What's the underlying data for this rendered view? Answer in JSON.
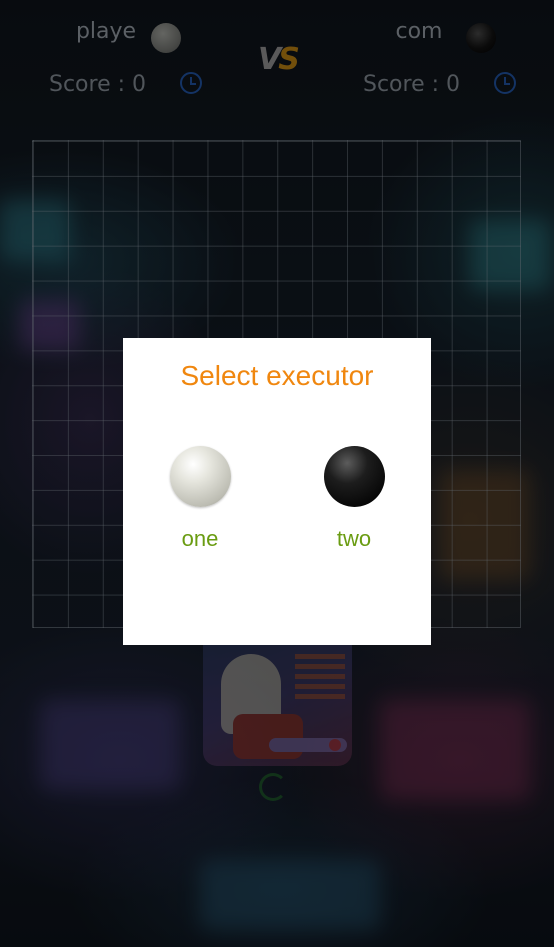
{
  "header": {
    "player1": {
      "name": "playe\nr",
      "score_label": "Score : 0",
      "stone": "white"
    },
    "player2": {
      "name": "com\nputer",
      "score_label": "Score : 0",
      "stone": "black"
    },
    "vs_label_v": "V",
    "vs_label_s": "S"
  },
  "board": {
    "rows": 14,
    "cols": 14
  },
  "dialog": {
    "title": "Select executor",
    "options": [
      {
        "label": "one",
        "stone": "white"
      },
      {
        "label": "two",
        "stone": "black"
      }
    ]
  },
  "colors": {
    "title": "#f0870f",
    "option_label": "#6a9c12",
    "clock": "#1f4f9a"
  }
}
